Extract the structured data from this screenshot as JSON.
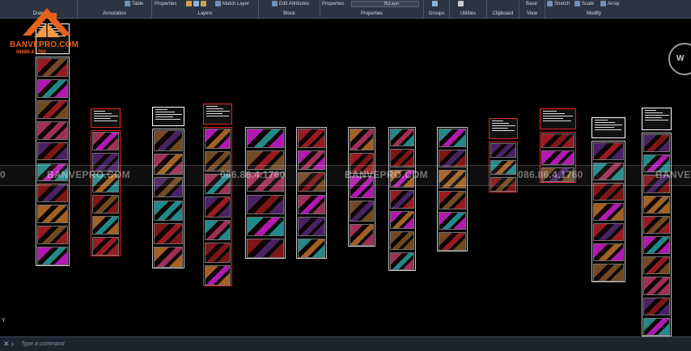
{
  "ribbon": {
    "draw": {
      "label": "Draw"
    },
    "annotation": {
      "label": "Annotation",
      "table": "Table"
    },
    "layers": {
      "label": "Layers",
      "properties": "Properties",
      "match_layer": "Match Layer"
    },
    "block": {
      "label": "Block",
      "edit_attributes": "Edit Attributes"
    },
    "properties": {
      "label": "Properties",
      "match_properties": "Properties",
      "bylayer": "ByLayer"
    },
    "groups": {
      "label": "Groups"
    },
    "utilities": {
      "label": "Utilities"
    },
    "clipboard": {
      "label": "Clipboard"
    },
    "view": {
      "label": "View"
    },
    "modify": {
      "label": "Modify",
      "stretch": "Stretch",
      "scale": "Scale",
      "array": "Array"
    },
    "base": "Base"
  },
  "logo": {
    "name": "BANVEPRO.COM",
    "phone": "08686.4.1760"
  },
  "watermarks": {
    "brand_left": "BANVEPRO.COM",
    "phone_left": "086.86.4.1760",
    "brand_mid": "BANVEPRO.COM",
    "phone_right": "086.86.4.1760",
    "brand_right": "BANVE",
    "zero": "0"
  },
  "viewcube": {
    "label": "W"
  },
  "ucs": {
    "label": "Y"
  },
  "command": {
    "placeholder": "Type a command"
  },
  "colors": {
    "background": "#000000",
    "ribbon": "#2b3442",
    "accent_red": "#e02828",
    "accent_magenta": "#d81fd8",
    "brand_orange": "#e8611a"
  }
}
